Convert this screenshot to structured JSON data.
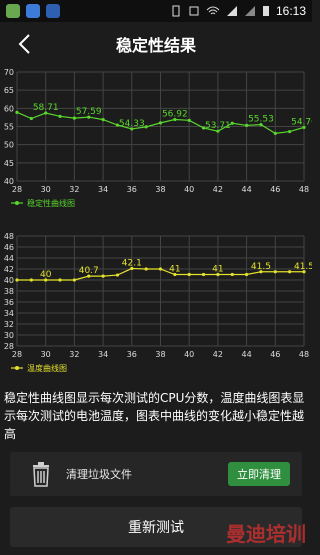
{
  "status": {
    "time": "16:13"
  },
  "header": {
    "title": "稳定性结果"
  },
  "chart_data": [
    {
      "type": "line",
      "name": "cpu",
      "x": [
        28,
        29,
        30,
        31,
        32,
        33,
        34,
        35,
        36,
        37,
        38,
        39,
        40,
        41,
        42,
        43,
        44,
        45,
        46,
        47,
        48
      ],
      "ylim": [
        40,
        70
      ],
      "yticks": [
        40,
        45,
        50,
        55,
        60,
        65,
        70
      ],
      "xticks": [
        28,
        30,
        32,
        34,
        36,
        38,
        40,
        42,
        44,
        46,
        48
      ],
      "series": [
        {
          "name": "稳定性曲线图",
          "color": "#59d62c",
          "values": [
            58.9,
            57.2,
            58.71,
            57.8,
            57.3,
            57.59,
            56.9,
            55.4,
            54.33,
            54.9,
            56.0,
            56.92,
            56.7,
            54.6,
            53.71,
            55.9,
            55.3,
            55.53,
            53.1,
            53.6,
            54.76
          ]
        }
      ],
      "data_labels": [
        {
          "x": 30,
          "text": "58.71"
        },
        {
          "x": 33,
          "text": "57.59"
        },
        {
          "x": 36,
          "text": "54.33"
        },
        {
          "x": 39,
          "text": "56.92"
        },
        {
          "x": 42,
          "text": "53.71"
        },
        {
          "x": 45,
          "text": "55.53"
        },
        {
          "x": 48,
          "text": "54.76"
        }
      ]
    },
    {
      "type": "line",
      "name": "temp",
      "x": [
        28,
        29,
        30,
        31,
        32,
        33,
        34,
        35,
        36,
        37,
        38,
        39,
        40,
        41,
        42,
        43,
        44,
        45,
        46,
        47,
        48
      ],
      "ylim": [
        28,
        48
      ],
      "yticks": [
        28,
        30,
        32,
        34,
        36,
        38,
        40,
        42,
        44,
        46,
        48
      ],
      "xticks": [
        28,
        30,
        32,
        34,
        36,
        38,
        40,
        42,
        44,
        46,
        48
      ],
      "series": [
        {
          "name": "温度曲线图",
          "color": "#e3e12b",
          "values": [
            40,
            40,
            40,
            40,
            40,
            40.7,
            40.7,
            40.9,
            42.1,
            42,
            42,
            41,
            41,
            41,
            41,
            41,
            41,
            41.5,
            41.5,
            41.5,
            41.5
          ]
        }
      ],
      "data_labels": [
        {
          "x": 30,
          "text": "40"
        },
        {
          "x": 33,
          "text": "40.7"
        },
        {
          "x": 36,
          "text": "42.1"
        },
        {
          "x": 39,
          "text": "41"
        },
        {
          "x": 42,
          "text": "41"
        },
        {
          "x": 45,
          "text": "41.5"
        },
        {
          "x": 48,
          "text": "41.5"
        }
      ]
    }
  ],
  "description": "稳定性曲线图显示每次测试的CPU分数，温度曲线图表显示每次测试的电池温度，图表中曲线的变化越小稳定性越高",
  "clean": {
    "label": "清理垃圾文件",
    "button": "立即清理"
  },
  "retest_label": "重新测试",
  "watermark": "曼迪培训"
}
